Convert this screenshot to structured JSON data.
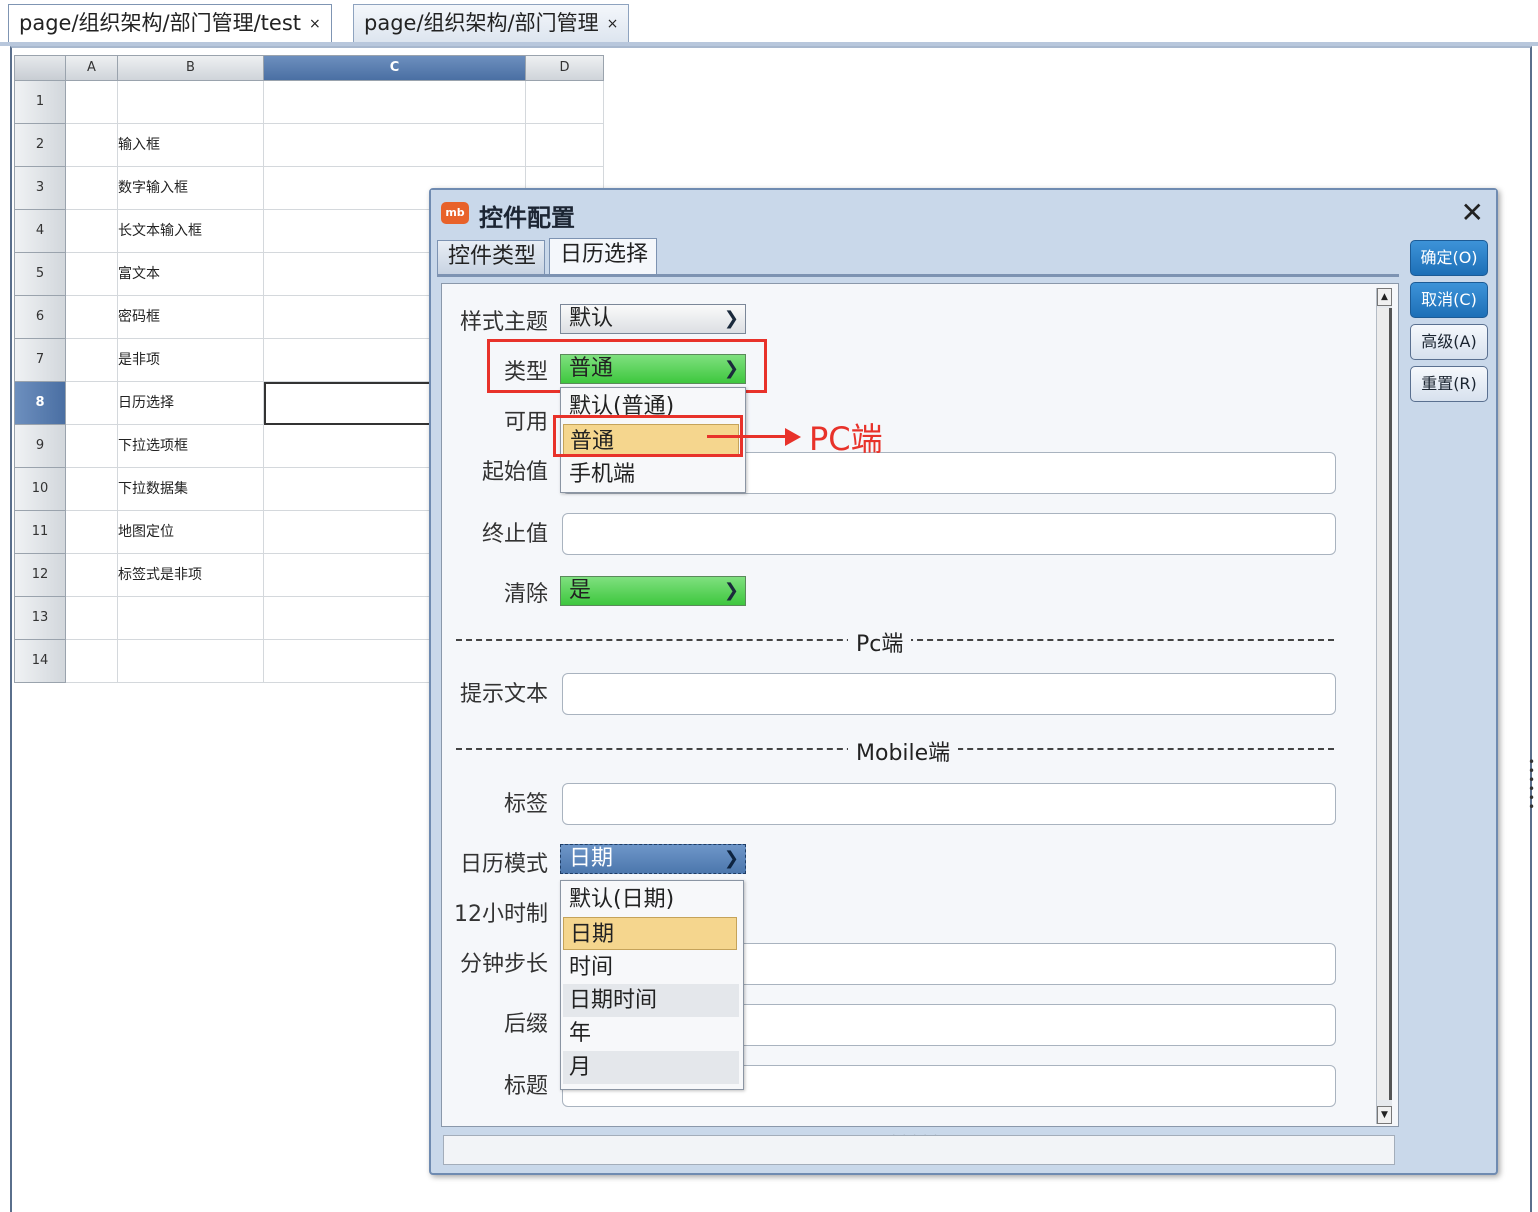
{
  "tabs": [
    {
      "label": "page/组织架构/部门管理/test",
      "close": "×"
    },
    {
      "label": "page/组织架构/部门管理",
      "close": "×"
    }
  ],
  "sheet": {
    "columns": [
      "A",
      "B",
      "C",
      "D"
    ],
    "rows": [
      {
        "num": "1",
        "b": ""
      },
      {
        "num": "2",
        "b": "输入框"
      },
      {
        "num": "3",
        "b": "数字输入框"
      },
      {
        "num": "4",
        "b": "长文本输入框"
      },
      {
        "num": "5",
        "b": "富文本"
      },
      {
        "num": "6",
        "b": "密码框"
      },
      {
        "num": "7",
        "b": "是非项"
      },
      {
        "num": "8",
        "b": "日历选择"
      },
      {
        "num": "9",
        "b": "下拉选项框"
      },
      {
        "num": "10",
        "b": "下拉数据集"
      },
      {
        "num": "11",
        "b": "地图定位"
      },
      {
        "num": "12",
        "b": "标签式是非项"
      },
      {
        "num": "13",
        "b": ""
      },
      {
        "num": "14",
        "b": ""
      }
    ]
  },
  "dialog": {
    "logo": "mb",
    "title": "控件配置",
    "close": "✕",
    "tabs": [
      "控件类型",
      "日历选择"
    ],
    "buttons": {
      "ok": "确定(O)",
      "cancel": "取消(C)",
      "advanced": "高级(A)",
      "reset": "重置(R)"
    },
    "fields": {
      "theme_label": "样式主题",
      "theme_value": "默认",
      "type_label": "类型",
      "type_value": "普通",
      "enabled_label": "可用",
      "start_label": "起始值",
      "end_label": "终止值",
      "clear_label": "清除",
      "clear_value": "是",
      "sep_pc": "Pc端",
      "hint_label": "提示文本",
      "sep_mobile": "Mobile端",
      "tag_label": "标签",
      "mode_label": "日历模式",
      "mode_value": "日期",
      "hour12_label": "12小时制",
      "step_label": "分钟步长",
      "suffix_label": "后缀",
      "title_label": "标题"
    },
    "type_options": [
      "默认(普通)",
      "普通",
      "手机端"
    ],
    "mode_options": [
      "默认(日期)",
      "日期",
      "时间",
      "日期时间",
      "年",
      "月"
    ],
    "annotation": "PC端",
    "grip": "•••••"
  },
  "colors": {
    "accent_red": "#e8322a",
    "combo_green": "#3ec73e",
    "highlight": "#f5d68e",
    "primary_button": "#1d6fb7"
  }
}
